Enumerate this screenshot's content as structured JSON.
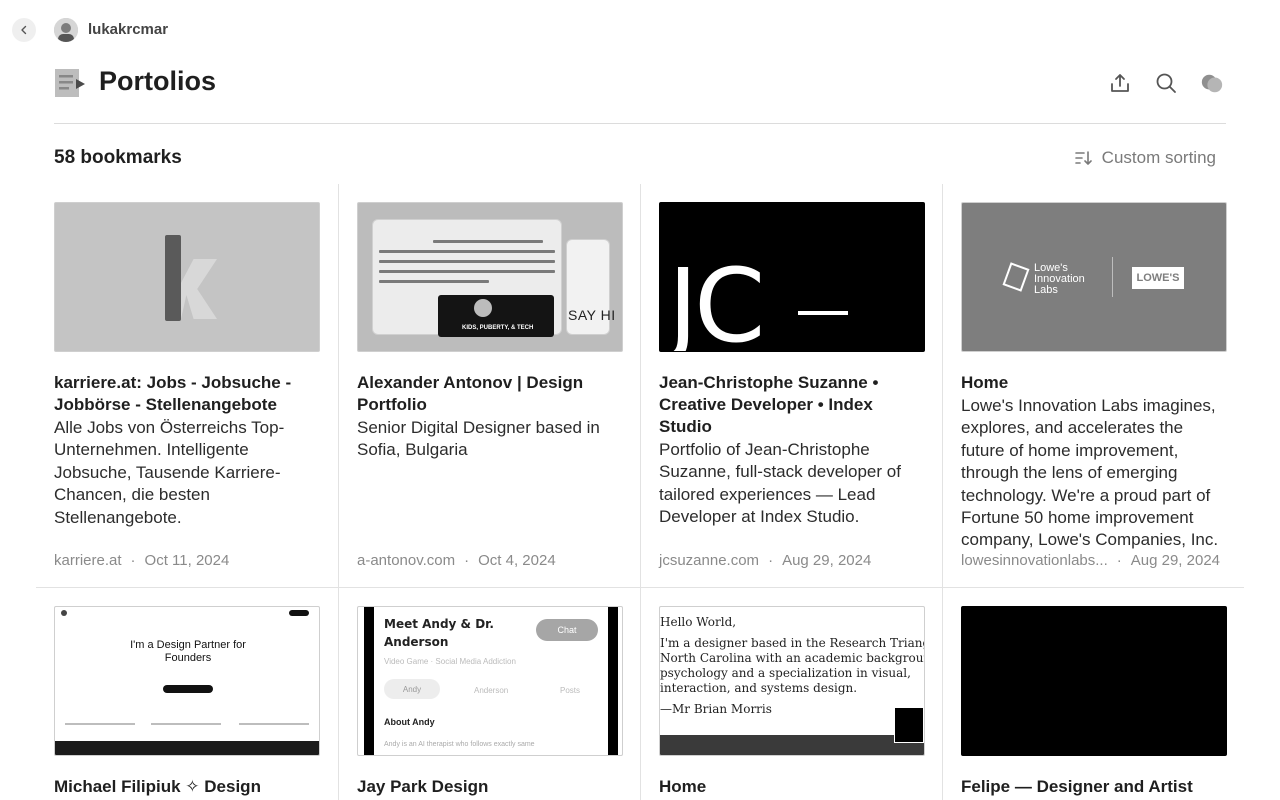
{
  "user": {
    "name": "lukakrcmar"
  },
  "header": {
    "title": "Portolios"
  },
  "toolbar": {
    "count_label": "58 bookmarks",
    "sort_label": "Custom sorting"
  },
  "cards": [
    {
      "title": "karriere.at: Jobs - Jobsuche - Jobbörse - Stellenangebote",
      "description": "Alle Jobs von Österreichs Top-Unternehmen. Intelligente Jobsuche, Tausende Karriere-Chancen, die besten Stellenangebote.",
      "domain": "karriere.at",
      "date": "Oct 11, 2024"
    },
    {
      "title": "Alexander Antonov | Design Portfolio",
      "description": "Senior Digital Designer based in Sofia, Bulgaria",
      "domain": "a-antonov.com",
      "date": "Oct 4, 2024",
      "thumb_text": "SAY HI",
      "thumb_dark_text": "KIDS, PUBERTY, & TECH"
    },
    {
      "title": "Jean-Christophe Suzanne • Creative Developer • Index Studio",
      "description": "Portfolio of Jean-Christophe Suzanne, full-stack developer of tailored experiences — Lead Developer at Index Studio.",
      "domain": "jcsuzanne.com",
      "date": "Aug 29, 2024",
      "thumb_text": "JC"
    },
    {
      "title": "Home",
      "description": "Lowe's Innovation Labs imagines, explores, and accelerates the future of home improvement, through the lens of emerging technology. We're a proud part of Fortune 50 home improvement company, Lowe's Companies, Inc.",
      "domain": "lowesinnovationlabs...",
      "date": "Aug 29, 2024",
      "thumb_text": "Lowe's Innovation Labs",
      "thumb_logo": "LOWE'S"
    },
    {
      "title": "Michael Filipiuk ✧ Design Partner",
      "thumb_text": "I'm a Design Partner for Founders"
    },
    {
      "title": "Jay Park Design",
      "thumb_heading": "Meet Andy & Dr. Anderson",
      "thumb_chat": "Chat",
      "thumb_sub": "Video Game · Social Media Addiction",
      "thumb_tabs": [
        "Andy",
        "Anderson",
        "Posts"
      ],
      "thumb_about": "About Andy",
      "thumb_body": "Andy is an AI therapist who follows exactly same"
    },
    {
      "title": "Home",
      "thumb_lines": [
        "Hello World,",
        "I'm a designer based in the Research Triangle area of",
        "North Carolina with an academic background in",
        "psychology and a specialization in visual,",
        "interaction, and systems design.",
        "—Mr Brian Morris"
      ]
    },
    {
      "title": "Felipe — Designer and Artist"
    }
  ]
}
